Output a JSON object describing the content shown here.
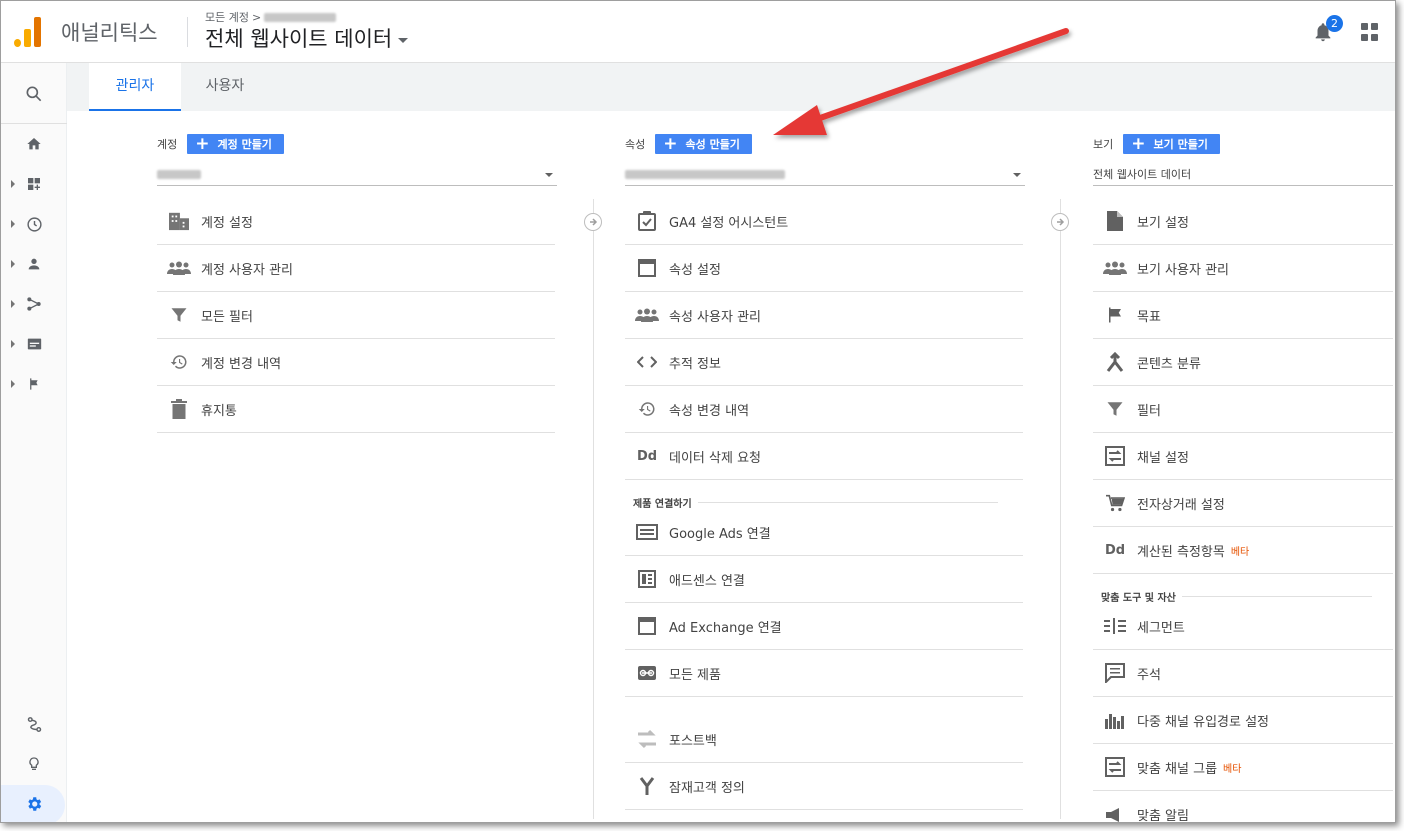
{
  "app": {
    "name": "애널리틱스"
  },
  "breadcrumb": {
    "root": "모든 계정",
    "sep": ">"
  },
  "view_title": "전체 웹사이트 데이터",
  "notifications": {
    "count": "2"
  },
  "tabs": [
    {
      "label": "관리자"
    },
    {
      "label": "사용자"
    }
  ],
  "columns": {
    "account": {
      "header": "계정",
      "create_label": "계정 만들기",
      "items": [
        {
          "label": "계정 설정",
          "icon": "building-icon"
        },
        {
          "label": "계정 사용자 관리",
          "icon": "people-icon"
        },
        {
          "label": "모든 필터",
          "icon": "filter-icon"
        },
        {
          "label": "계정 변경 내역",
          "icon": "history-icon"
        },
        {
          "label": "휴지통",
          "icon": "trash-icon"
        }
      ]
    },
    "property": {
      "header": "속성",
      "create_label": "속성 만들기",
      "items": [
        {
          "label": "GA4 설정 어시스턴트",
          "icon": "checklist-icon"
        },
        {
          "label": "속성 설정",
          "icon": "window-icon"
        },
        {
          "label": "속성 사용자 관리",
          "icon": "people-icon"
        },
        {
          "label": "추적 정보",
          "icon": "code-icon"
        },
        {
          "label": "속성 변경 내역",
          "icon": "history-icon"
        },
        {
          "label": "데이터 삭제 요청",
          "icon": "dd-icon"
        }
      ],
      "section": "제품 연결하기",
      "link_items": [
        {
          "label": "Google Ads 연결",
          "icon": "ads-icon"
        },
        {
          "label": "애드센스 연결",
          "icon": "adsense-icon"
        },
        {
          "label": "Ad Exchange 연결",
          "icon": "window-icon"
        },
        {
          "label": "모든 제품",
          "icon": "link-icon"
        }
      ],
      "extra_items": [
        {
          "label": "포스트백",
          "icon": "swap-icon"
        },
        {
          "label": "잠재고객 정의",
          "icon": "fork-icon"
        }
      ]
    },
    "view": {
      "header": "보기",
      "create_label": "보기 만들기",
      "selected": "전체 웹사이트 데이터",
      "items": [
        {
          "label": "보기 설정",
          "icon": "document-icon"
        },
        {
          "label": "보기 사용자 관리",
          "icon": "people-icon"
        },
        {
          "label": "목표",
          "icon": "flag-icon"
        },
        {
          "label": "콘텐츠 분류",
          "icon": "merge-icon"
        },
        {
          "label": "필터",
          "icon": "filter-icon"
        },
        {
          "label": "채널 설정",
          "icon": "channel-icon"
        },
        {
          "label": "전자상거래 설정",
          "icon": "cart-icon"
        },
        {
          "label": "계산된 측정항목",
          "icon": "dd-icon",
          "badge": "베타"
        }
      ],
      "section": "맞춤 도구 및 자산",
      "tool_items": [
        {
          "label": "세그먼트",
          "icon": "segment-icon"
        },
        {
          "label": "주석",
          "icon": "comment-icon"
        },
        {
          "label": "다중 채널 유입경로 설정",
          "icon": "bars-icon"
        },
        {
          "label": "맞춤 채널 그룹",
          "icon": "channel-icon",
          "badge": "베타"
        },
        {
          "label": "맞춤 알림",
          "icon": "megaphone-icon"
        }
      ]
    }
  },
  "colors": {
    "accent": "#1a73e8",
    "button": "#4285f4",
    "annotation_arrow": "#e53935",
    "beta": "#e65100"
  }
}
